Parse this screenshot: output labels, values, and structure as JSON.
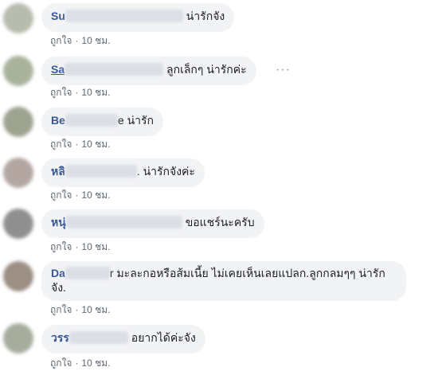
{
  "comments": [
    {
      "name": "Su",
      "text": "น่ารักจัง",
      "like_label": "ถูกใจ",
      "separator": "·",
      "time": "10 ชม.",
      "avatar_color": "#b7bcae"
    },
    {
      "name": "Sa",
      "text": "ลูกเล็กๆ น่ารักค่ะ",
      "like_label": "ถูกใจ",
      "separator": "·",
      "time": "10 ชม.",
      "avatar_color": "#a9b39c",
      "more_label": "···"
    },
    {
      "name": "Be",
      "text": "e น่ารัก",
      "like_label": "ถูกใจ",
      "separator": "·",
      "time": "10 ชม.",
      "avatar_color": "#9ea48f"
    },
    {
      "name": "หลิ",
      "text": ". น่ารักจังค่ะ",
      "like_label": "ถูกใจ",
      "separator": "·",
      "time": "10 ชม.",
      "avatar_color": "#b4a7a2"
    },
    {
      "name": "หนุ่",
      "text": "ขอแชร์นะครับ",
      "like_label": "ถูกใจ",
      "separator": "·",
      "time": "10 ชม.",
      "avatar_color": "#8f8f8f"
    },
    {
      "name": "Da",
      "text": "r มะละกอหรือส้มเนี้ย ไม่เคยเห็นเลยแปลก.ลูกกลมๆๆ น่ารักจัง.",
      "like_label": "ถูกใจ",
      "separator": "·",
      "time": "10 ชม.",
      "avatar_color": "#9c8f84"
    },
    {
      "name": "วรร",
      "text": "อยากได้ค่ะจัง",
      "like_label": "ถูกใจ",
      "separator": "·",
      "time": "10 ชม.",
      "avatar_color": "#a6ad9d"
    }
  ]
}
